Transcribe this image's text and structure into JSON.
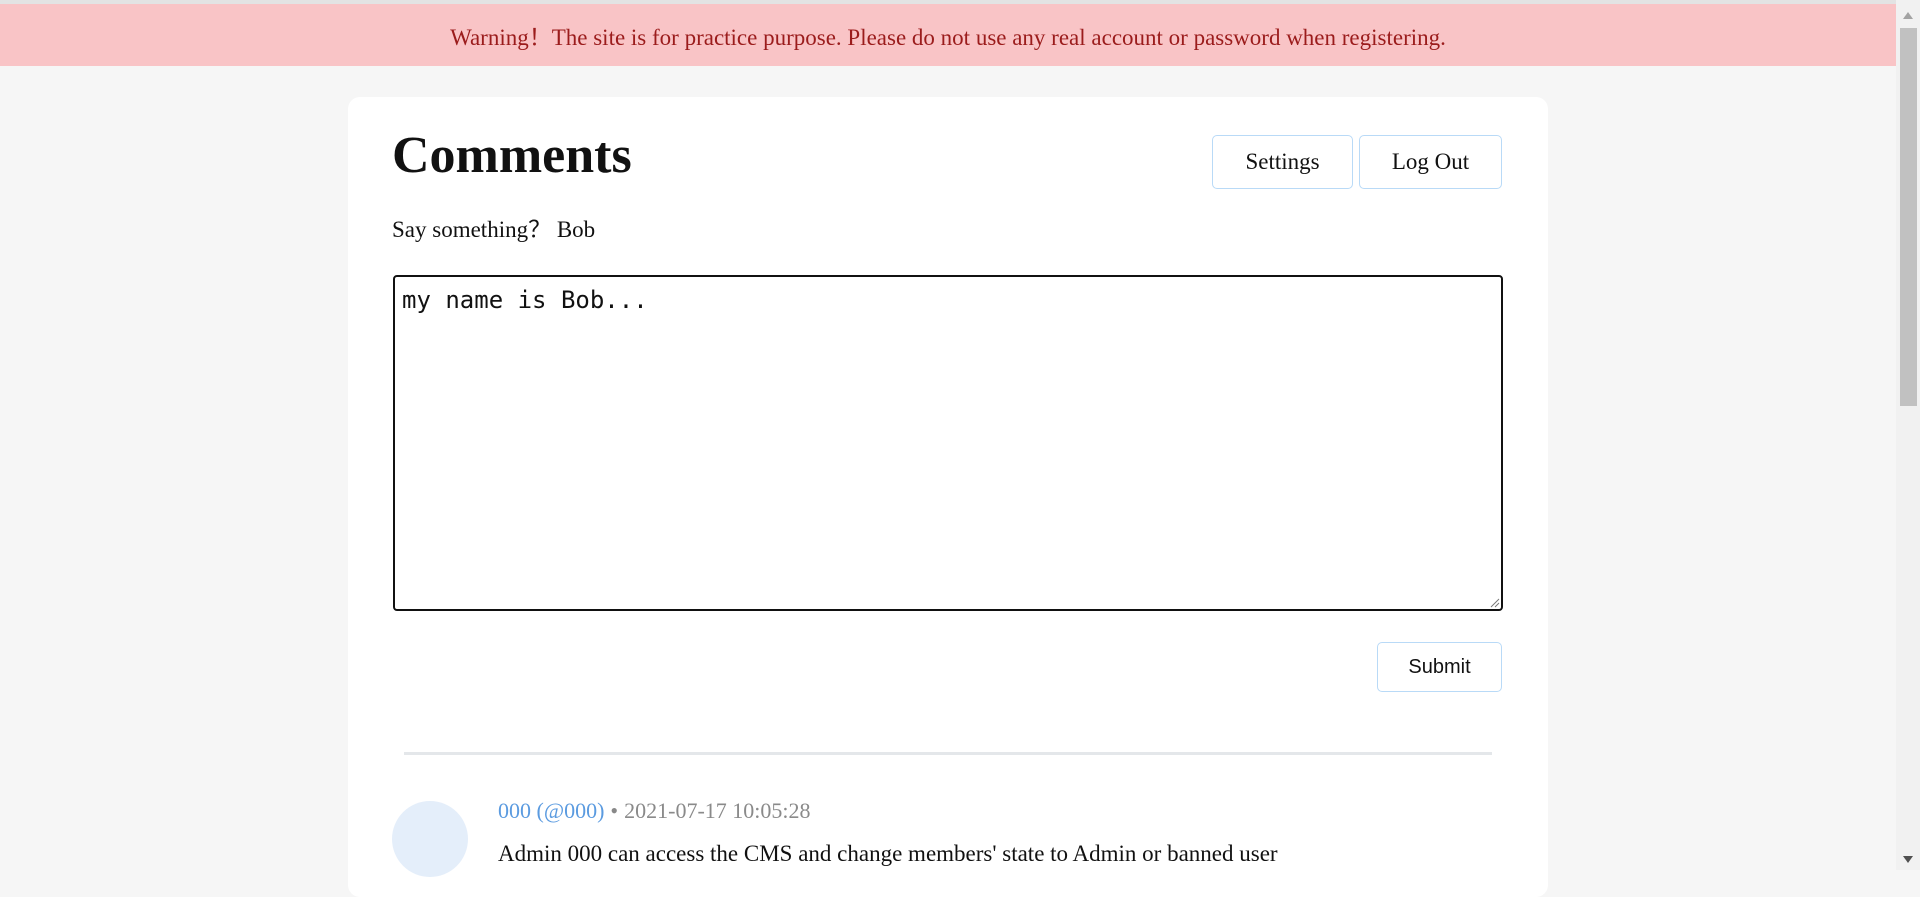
{
  "banner": {
    "text": "Warning！The site is for practice purpose. Please do not use any real account or password when registering."
  },
  "header": {
    "title": "Comments",
    "settings_label": "Settings",
    "logout_label": "Log Out"
  },
  "composer": {
    "prompt": "Say something？ Bob",
    "value": "my name is Bob...",
    "submit_label": "Submit"
  },
  "comments": [
    {
      "author": "000 (@000)",
      "separator": "•",
      "timestamp": "2021-07-17 10:05:28",
      "text": "Admin 000 can access the CMS and change members' state to Admin or banned user"
    }
  ],
  "colors": {
    "banner_bg": "#f9c4c6",
    "banner_text": "#9b1c1c",
    "author_link": "#5b9be0",
    "button_border": "#b9daf7"
  },
  "icons": {
    "avatar": "avatar-placeholder",
    "scroll_up": "arrow-up-icon",
    "scroll_down": "arrow-down-icon",
    "resize": "resize-grip-icon"
  }
}
